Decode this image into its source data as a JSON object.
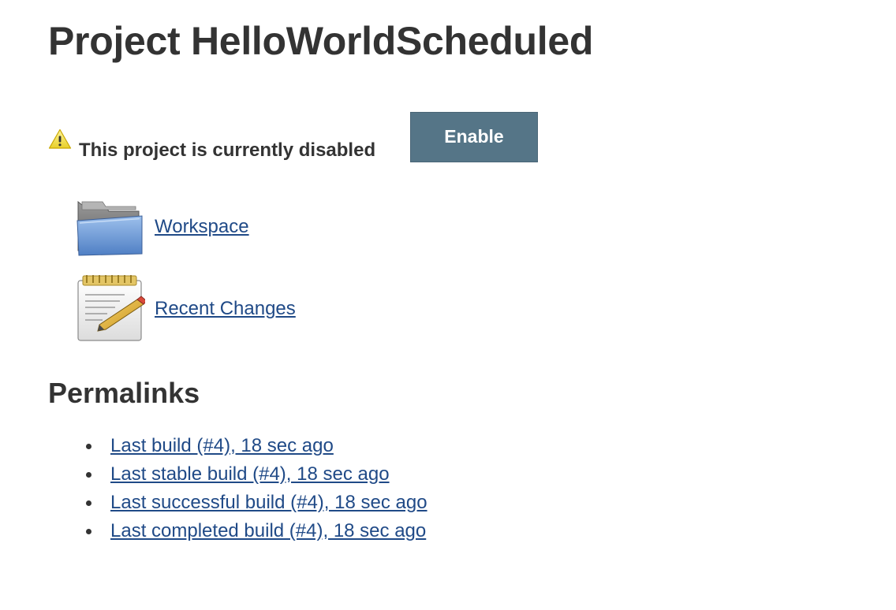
{
  "page": {
    "title": "Project HelloWorldScheduled"
  },
  "status": {
    "icon": "warning-icon",
    "message": "This project is currently disabled",
    "enable_button_label": "Enable",
    "button_color": "#557587"
  },
  "task_links": [
    {
      "icon": "folder-icon",
      "label": "Workspace"
    },
    {
      "icon": "notepad-icon",
      "label": "Recent Changes"
    }
  ],
  "permalinks": {
    "heading": "Permalinks",
    "items": [
      {
        "label": "Last build (#4), 18 sec ago"
      },
      {
        "label": "Last stable build (#4), 18 sec ago"
      },
      {
        "label": "Last successful build (#4), 18 sec ago"
      },
      {
        "label": "Last completed build (#4), 18 sec ago"
      }
    ]
  },
  "colors": {
    "text": "#333333",
    "link": "#204a87",
    "background": "#ffffff"
  }
}
